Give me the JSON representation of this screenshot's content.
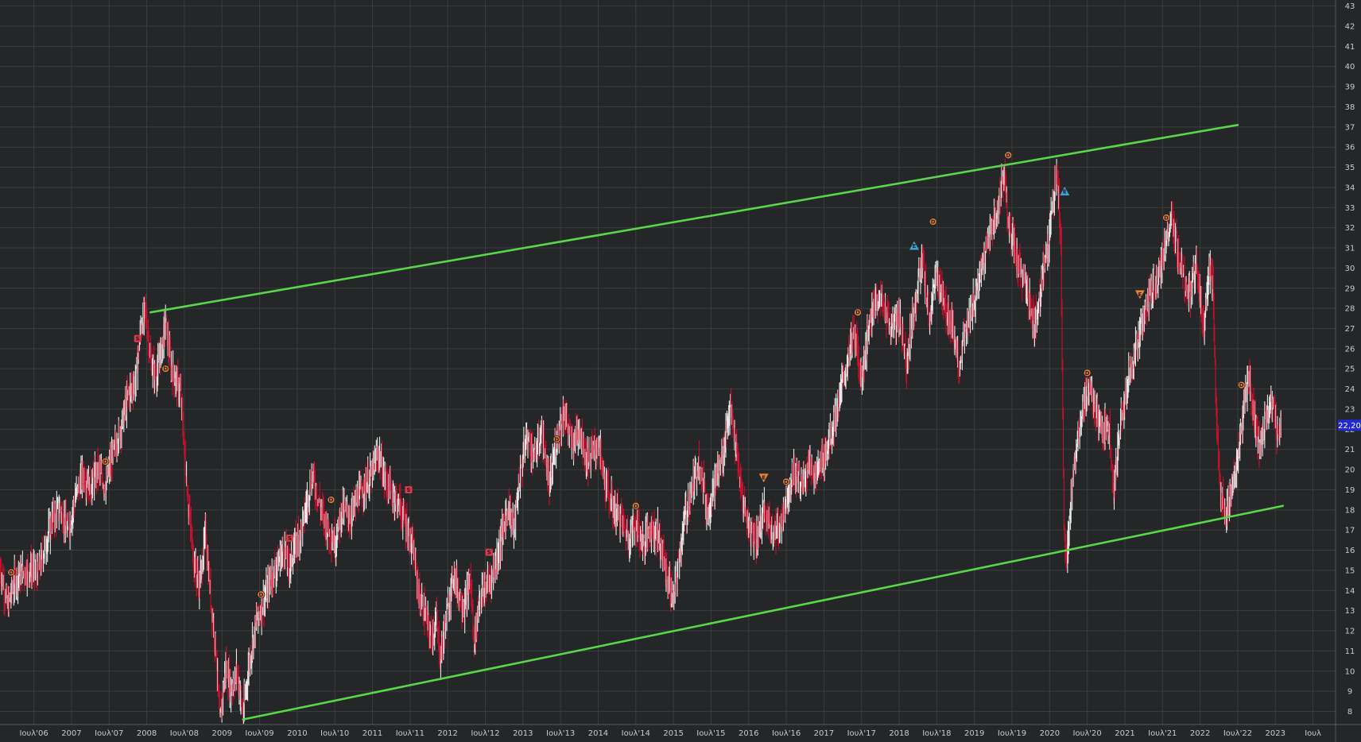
{
  "chart_data": {
    "type": "line",
    "title": "",
    "xlabel": "",
    "ylabel": "",
    "xlim": [
      2006.05,
      2023.8
    ],
    "ylim": [
      7.35,
      43.3
    ],
    "y_ticks": [
      8,
      9,
      10,
      11,
      12,
      13,
      14,
      15,
      16,
      17,
      18,
      19,
      20,
      21,
      22,
      23,
      24,
      25,
      26,
      27,
      28,
      29,
      30,
      31,
      32,
      33,
      34,
      35,
      36,
      37,
      38,
      39,
      40,
      41,
      42,
      43
    ],
    "x_ticks": [
      {
        "t": 2006.5,
        "label": "Ιουλ'06"
      },
      {
        "t": 2007.0,
        "label": "2007"
      },
      {
        "t": 2007.5,
        "label": "Ιουλ'07"
      },
      {
        "t": 2008.0,
        "label": "2008"
      },
      {
        "t": 2008.5,
        "label": "Ιουλ'08"
      },
      {
        "t": 2009.0,
        "label": "2009"
      },
      {
        "t": 2009.5,
        "label": "Ιουλ'09"
      },
      {
        "t": 2010.0,
        "label": "2010"
      },
      {
        "t": 2010.5,
        "label": "Ιουλ'10"
      },
      {
        "t": 2011.0,
        "label": "2011"
      },
      {
        "t": 2011.5,
        "label": "Ιουλ'11"
      },
      {
        "t": 2012.0,
        "label": "2012"
      },
      {
        "t": 2012.5,
        "label": "Ιουλ'12"
      },
      {
        "t": 2013.0,
        "label": "2013"
      },
      {
        "t": 2013.5,
        "label": "Ιουλ'13"
      },
      {
        "t": 2014.0,
        "label": "2014"
      },
      {
        "t": 2014.5,
        "label": "Ιουλ'14"
      },
      {
        "t": 2015.0,
        "label": "2015"
      },
      {
        "t": 2015.5,
        "label": "Ιουλ'15"
      },
      {
        "t": 2016.0,
        "label": "2016"
      },
      {
        "t": 2016.5,
        "label": "Ιουλ'16"
      },
      {
        "t": 2017.0,
        "label": "2017"
      },
      {
        "t": 2017.5,
        "label": "Ιουλ'17"
      },
      {
        "t": 2018.0,
        "label": "2018"
      },
      {
        "t": 2018.5,
        "label": "Ιουλ'18"
      },
      {
        "t": 2019.0,
        "label": "2019"
      },
      {
        "t": 2019.5,
        "label": "Ιουλ'19"
      },
      {
        "t": 2020.0,
        "label": "2020"
      },
      {
        "t": 2020.5,
        "label": "Ιουλ'20"
      },
      {
        "t": 2021.0,
        "label": "2021"
      },
      {
        "t": 2021.5,
        "label": "Ιουλ'21"
      },
      {
        "t": 2022.0,
        "label": "2022"
      },
      {
        "t": 2022.5,
        "label": "Ιουλ'22"
      },
      {
        "t": 2023.0,
        "label": "2023"
      },
      {
        "t": 2023.5,
        "label": "Ιουλ"
      }
    ],
    "grid": true,
    "up_color": "#e8e8e8",
    "down_color": "#c8102e",
    "background": "#242627",
    "grid_color": "#3a3d3f",
    "trendline_color": "#5ad64a",
    "price_series": [
      {
        "t": 2006.05,
        "v": 15.2
      },
      {
        "t": 2006.15,
        "v": 13.2
      },
      {
        "t": 2006.25,
        "v": 14.6
      },
      {
        "t": 2006.35,
        "v": 14.9
      },
      {
        "t": 2006.45,
        "v": 15.1
      },
      {
        "t": 2006.55,
        "v": 14.8
      },
      {
        "t": 2006.65,
        "v": 16.2
      },
      {
        "t": 2006.75,
        "v": 17.6
      },
      {
        "t": 2006.85,
        "v": 18.1
      },
      {
        "t": 2006.95,
        "v": 16.9
      },
      {
        "t": 2007.05,
        "v": 18.6
      },
      {
        "t": 2007.15,
        "v": 19.8
      },
      {
        "t": 2007.25,
        "v": 19.1
      },
      {
        "t": 2007.35,
        "v": 20.0
      },
      {
        "t": 2007.45,
        "v": 19.2
      },
      {
        "t": 2007.55,
        "v": 20.8
      },
      {
        "t": 2007.65,
        "v": 22.0
      },
      {
        "t": 2007.75,
        "v": 23.7
      },
      {
        "t": 2007.85,
        "v": 24.4
      },
      {
        "t": 2007.92,
        "v": 27.0
      },
      {
        "t": 2007.98,
        "v": 27.9
      },
      {
        "t": 2008.05,
        "v": 25.4
      },
      {
        "t": 2008.12,
        "v": 24.6
      },
      {
        "t": 2008.2,
        "v": 26.0
      },
      {
        "t": 2008.25,
        "v": 27.4
      },
      {
        "t": 2008.32,
        "v": 25.1
      },
      {
        "t": 2008.4,
        "v": 24.3
      },
      {
        "t": 2008.45,
        "v": 23.8
      },
      {
        "t": 2008.5,
        "v": 21.0
      },
      {
        "t": 2008.55,
        "v": 18.4
      },
      {
        "t": 2008.62,
        "v": 15.6
      },
      {
        "t": 2008.7,
        "v": 14.2
      },
      {
        "t": 2008.78,
        "v": 16.8
      },
      {
        "t": 2008.85,
        "v": 13.6
      },
      {
        "t": 2008.92,
        "v": 11.1
      },
      {
        "t": 2008.97,
        "v": 7.4
      },
      {
        "t": 2009.05,
        "v": 10.2
      },
      {
        "t": 2009.12,
        "v": 9.1
      },
      {
        "t": 2009.2,
        "v": 10.0
      },
      {
        "t": 2009.28,
        "v": 7.8
      },
      {
        "t": 2009.35,
        "v": 10.1
      },
      {
        "t": 2009.45,
        "v": 12.4
      },
      {
        "t": 2009.55,
        "v": 13.4
      },
      {
        "t": 2009.65,
        "v": 14.6
      },
      {
        "t": 2009.75,
        "v": 15.4
      },
      {
        "t": 2009.82,
        "v": 16.1
      },
      {
        "t": 2009.9,
        "v": 15.2
      },
      {
        "t": 2009.98,
        "v": 16.3
      },
      {
        "t": 2010.08,
        "v": 17.4
      },
      {
        "t": 2010.2,
        "v": 19.8
      },
      {
        "t": 2010.3,
        "v": 18.2
      },
      {
        "t": 2010.4,
        "v": 17.1
      },
      {
        "t": 2010.5,
        "v": 16.4
      },
      {
        "t": 2010.6,
        "v": 18.1
      },
      {
        "t": 2010.7,
        "v": 17.6
      },
      {
        "t": 2010.8,
        "v": 18.6
      },
      {
        "t": 2010.9,
        "v": 19.2
      },
      {
        "t": 2011.0,
        "v": 19.8
      },
      {
        "t": 2011.08,
        "v": 20.9
      },
      {
        "t": 2011.15,
        "v": 19.6
      },
      {
        "t": 2011.25,
        "v": 18.9
      },
      {
        "t": 2011.35,
        "v": 18.3
      },
      {
        "t": 2011.45,
        "v": 17.2
      },
      {
        "t": 2011.55,
        "v": 15.8
      },
      {
        "t": 2011.62,
        "v": 13.7
      },
      {
        "t": 2011.7,
        "v": 12.8
      },
      {
        "t": 2011.78,
        "v": 11.6
      },
      {
        "t": 2011.85,
        "v": 12.5
      },
      {
        "t": 2011.9,
        "v": 10.7
      },
      {
        "t": 2011.98,
        "v": 12.6
      },
      {
        "t": 2012.08,
        "v": 14.9
      },
      {
        "t": 2012.15,
        "v": 13.8
      },
      {
        "t": 2012.22,
        "v": 13.1
      },
      {
        "t": 2012.3,
        "v": 14.6
      },
      {
        "t": 2012.35,
        "v": 11.4
      },
      {
        "t": 2012.42,
        "v": 13.6
      },
      {
        "t": 2012.5,
        "v": 14.1
      },
      {
        "t": 2012.6,
        "v": 14.8
      },
      {
        "t": 2012.7,
        "v": 16.4
      },
      {
        "t": 2012.8,
        "v": 18.2
      },
      {
        "t": 2012.88,
        "v": 17.1
      },
      {
        "t": 2012.95,
        "v": 19.4
      },
      {
        "t": 2013.05,
        "v": 21.7
      },
      {
        "t": 2013.15,
        "v": 20.6
      },
      {
        "t": 2013.25,
        "v": 21.9
      },
      {
        "t": 2013.35,
        "v": 19.1
      },
      {
        "t": 2013.45,
        "v": 21.6
      },
      {
        "t": 2013.55,
        "v": 22.9
      },
      {
        "t": 2013.65,
        "v": 21.2
      },
      {
        "t": 2013.75,
        "v": 22.1
      },
      {
        "t": 2013.85,
        "v": 20.4
      },
      {
        "t": 2014.0,
        "v": 21.3
      },
      {
        "t": 2014.1,
        "v": 19.2
      },
      {
        "t": 2014.2,
        "v": 18.1
      },
      {
        "t": 2014.3,
        "v": 17.6
      },
      {
        "t": 2014.4,
        "v": 16.6
      },
      {
        "t": 2014.5,
        "v": 17.4
      },
      {
        "t": 2014.6,
        "v": 16.3
      },
      {
        "t": 2014.7,
        "v": 17.2
      },
      {
        "t": 2014.8,
        "v": 16.8
      },
      {
        "t": 2014.88,
        "v": 15.3
      },
      {
        "t": 2014.95,
        "v": 14.2
      },
      {
        "t": 2015.0,
        "v": 13.6
      },
      {
        "t": 2015.08,
        "v": 15.8
      },
      {
        "t": 2015.15,
        "v": 17.6
      },
      {
        "t": 2015.25,
        "v": 19.1
      },
      {
        "t": 2015.35,
        "v": 20.5
      },
      {
        "t": 2015.45,
        "v": 17.8
      },
      {
        "t": 2015.55,
        "v": 19.4
      },
      {
        "t": 2015.65,
        "v": 20.6
      },
      {
        "t": 2015.75,
        "v": 23.1
      },
      {
        "t": 2015.82,
        "v": 21.3
      },
      {
        "t": 2015.9,
        "v": 18.9
      },
      {
        "t": 2016.0,
        "v": 17.1
      },
      {
        "t": 2016.1,
        "v": 16.6
      },
      {
        "t": 2016.2,
        "v": 17.9
      },
      {
        "t": 2016.3,
        "v": 17.2
      },
      {
        "t": 2016.4,
        "v": 16.9
      },
      {
        "t": 2016.5,
        "v": 18.6
      },
      {
        "t": 2016.6,
        "v": 19.9
      },
      {
        "t": 2016.7,
        "v": 19.3
      },
      {
        "t": 2016.8,
        "v": 20.3
      },
      {
        "t": 2016.9,
        "v": 19.6
      },
      {
        "t": 2017.0,
        "v": 20.7
      },
      {
        "t": 2017.1,
        "v": 21.8
      },
      {
        "t": 2017.2,
        "v": 23.4
      },
      {
        "t": 2017.3,
        "v": 25.2
      },
      {
        "t": 2017.4,
        "v": 26.8
      },
      {
        "t": 2017.5,
        "v": 24.6
      },
      {
        "t": 2017.6,
        "v": 27.1
      },
      {
        "t": 2017.7,
        "v": 28.6
      },
      {
        "t": 2017.8,
        "v": 28.1
      },
      {
        "t": 2017.9,
        "v": 26.9
      },
      {
        "t": 2018.0,
        "v": 27.6
      },
      {
        "t": 2018.1,
        "v": 25.3
      },
      {
        "t": 2018.2,
        "v": 28.1
      },
      {
        "t": 2018.3,
        "v": 30.4
      },
      {
        "t": 2018.4,
        "v": 27.4
      },
      {
        "t": 2018.5,
        "v": 29.8
      },
      {
        "t": 2018.6,
        "v": 28.1
      },
      {
        "t": 2018.7,
        "v": 27.2
      },
      {
        "t": 2018.8,
        "v": 25.3
      },
      {
        "t": 2018.9,
        "v": 27.1
      },
      {
        "t": 2019.0,
        "v": 28.4
      },
      {
        "t": 2019.1,
        "v": 30.1
      },
      {
        "t": 2019.2,
        "v": 31.6
      },
      {
        "t": 2019.3,
        "v": 32.8
      },
      {
        "t": 2019.4,
        "v": 34.8
      },
      {
        "t": 2019.45,
        "v": 32.1
      },
      {
        "t": 2019.55,
        "v": 30.6
      },
      {
        "t": 2019.65,
        "v": 29.4
      },
      {
        "t": 2019.75,
        "v": 28.1
      },
      {
        "t": 2019.8,
        "v": 27.1
      },
      {
        "t": 2019.9,
        "v": 29.6
      },
      {
        "t": 2019.98,
        "v": 31.2
      },
      {
        "t": 2020.05,
        "v": 33.6
      },
      {
        "t": 2020.1,
        "v": 34.7
      },
      {
        "t": 2020.15,
        "v": 31.4
      },
      {
        "t": 2020.19,
        "v": 16.9
      },
      {
        "t": 2020.23,
        "v": 15.3
      },
      {
        "t": 2020.3,
        "v": 19.6
      },
      {
        "t": 2020.4,
        "v": 22.4
      },
      {
        "t": 2020.5,
        "v": 24.1
      },
      {
        "t": 2020.6,
        "v": 23.1
      },
      {
        "t": 2020.7,
        "v": 21.6
      },
      {
        "t": 2020.78,
        "v": 22.5
      },
      {
        "t": 2020.85,
        "v": 19.1
      },
      {
        "t": 2020.95,
        "v": 22.4
      },
      {
        "t": 2021.05,
        "v": 24.6
      },
      {
        "t": 2021.15,
        "v": 26.1
      },
      {
        "t": 2021.25,
        "v": 27.6
      },
      {
        "t": 2021.35,
        "v": 28.9
      },
      {
        "t": 2021.45,
        "v": 29.6
      },
      {
        "t": 2021.55,
        "v": 31.4
      },
      {
        "t": 2021.62,
        "v": 32.5
      },
      {
        "t": 2021.7,
        "v": 30.7
      },
      {
        "t": 2021.8,
        "v": 29.1
      },
      {
        "t": 2021.88,
        "v": 28.6
      },
      {
        "t": 2021.95,
        "v": 30.3
      },
      {
        "t": 2022.05,
        "v": 27.1
      },
      {
        "t": 2022.12,
        "v": 30.1
      },
      {
        "t": 2022.17,
        "v": 29.0
      },
      {
        "t": 2022.22,
        "v": 22.0
      },
      {
        "t": 2022.27,
        "v": 19.1
      },
      {
        "t": 2022.35,
        "v": 17.6
      },
      {
        "t": 2022.42,
        "v": 18.9
      },
      {
        "t": 2022.5,
        "v": 20.6
      },
      {
        "t": 2022.58,
        "v": 22.9
      },
      {
        "t": 2022.65,
        "v": 24.6
      },
      {
        "t": 2022.72,
        "v": 22.4
      },
      {
        "t": 2022.8,
        "v": 21.1
      },
      {
        "t": 2022.88,
        "v": 22.6
      },
      {
        "t": 2022.95,
        "v": 23.4
      },
      {
        "t": 2023.02,
        "v": 21.9
      },
      {
        "t": 2023.08,
        "v": 22.2
      }
    ],
    "last_price": {
      "value": 22.2,
      "label": "22,20",
      "color": "#1f2ad6"
    },
    "trendlines": [
      {
        "name": "upper-channel",
        "from": {
          "t": 2008.05,
          "v": 27.8
        },
        "to": {
          "t": 2022.5,
          "v": 37.1
        }
      },
      {
        "name": "lower-channel",
        "from": {
          "t": 2009.28,
          "v": 7.6
        },
        "to": {
          "t": 2023.1,
          "v": 18.2
        }
      }
    ],
    "markers": [
      {
        "t": 2006.2,
        "v": 14.9,
        "label": "D",
        "kind": "circle",
        "color": "#e8803a"
      },
      {
        "t": 2007.45,
        "v": 20.4,
        "label": "D",
        "kind": "circle",
        "color": "#e8803a"
      },
      {
        "t": 2007.88,
        "v": 26.5,
        "label": "S",
        "kind": "square",
        "color": "#d93c4a"
      },
      {
        "t": 2008.25,
        "v": 25.0,
        "label": "D",
        "kind": "circle",
        "color": "#e8803a"
      },
      {
        "t": 2009.52,
        "v": 13.8,
        "label": "D",
        "kind": "circle",
        "color": "#e8803a"
      },
      {
        "t": 2009.9,
        "v": 16.6,
        "label": "S",
        "kind": "square",
        "color": "#d93c4a"
      },
      {
        "t": 2010.45,
        "v": 18.5,
        "label": "D",
        "kind": "circle",
        "color": "#e8803a"
      },
      {
        "t": 2011.48,
        "v": 19.0,
        "label": "S",
        "kind": "square",
        "color": "#d93c4a"
      },
      {
        "t": 2012.55,
        "v": 15.9,
        "label": "S",
        "kind": "square",
        "color": "#d93c4a"
      },
      {
        "t": 2013.45,
        "v": 21.5,
        "label": "D",
        "kind": "circle",
        "color": "#e8803a"
      },
      {
        "t": 2014.5,
        "v": 18.2,
        "label": "D",
        "kind": "circle",
        "color": "#e8803a"
      },
      {
        "t": 2016.2,
        "v": 19.6,
        "label": "E",
        "kind": "triangle-down",
        "color": "#e8803a"
      },
      {
        "t": 2016.5,
        "v": 19.4,
        "label": "D",
        "kind": "circle",
        "color": "#e8803a"
      },
      {
        "t": 2017.45,
        "v": 27.8,
        "label": "D",
        "kind": "circle",
        "color": "#e8803a"
      },
      {
        "t": 2018.2,
        "v": 31.1,
        "label": "E",
        "kind": "triangle-up",
        "color": "#3aa6d6"
      },
      {
        "t": 2018.45,
        "v": 32.3,
        "label": "D",
        "kind": "circle",
        "color": "#e8803a"
      },
      {
        "t": 2019.45,
        "v": 35.6,
        "label": "D",
        "kind": "circle",
        "color": "#e8803a"
      },
      {
        "t": 2020.2,
        "v": 33.8,
        "label": "E",
        "kind": "triangle-up",
        "color": "#3aa6d6"
      },
      {
        "t": 2020.5,
        "v": 24.8,
        "label": "D",
        "kind": "circle",
        "color": "#e8803a"
      },
      {
        "t": 2021.2,
        "v": 28.7,
        "label": "E",
        "kind": "triangle-down",
        "color": "#e8803a"
      },
      {
        "t": 2021.55,
        "v": 32.5,
        "label": "D",
        "kind": "circle",
        "color": "#e8803a"
      },
      {
        "t": 2022.55,
        "v": 24.2,
        "label": "D",
        "kind": "circle",
        "color": "#e8803a"
      }
    ]
  }
}
